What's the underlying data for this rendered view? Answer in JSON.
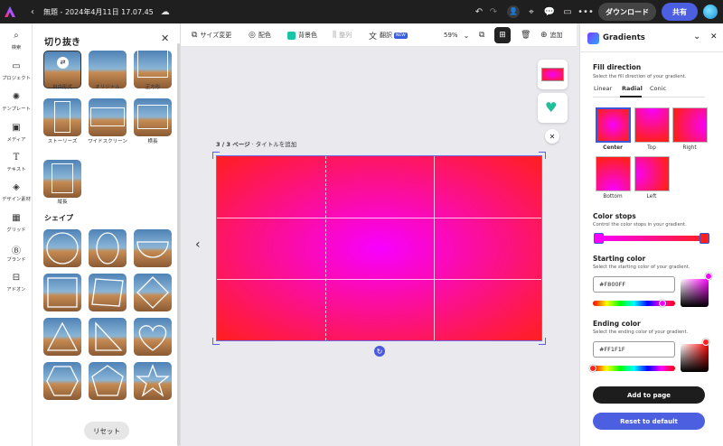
{
  "topbar": {
    "doc_title": "無題 - 2024年4月11日 17.07.45",
    "download_label": "ダウンロード",
    "share_label": "共有",
    "colors": {
      "bar_bg": "#1f1f1f",
      "share": "#4b5fe0",
      "download": "#444444"
    }
  },
  "rail": {
    "items": [
      {
        "label": "検索",
        "icon": "search-icon"
      },
      {
        "label": "プロジェクト",
        "icon": "folder-icon"
      },
      {
        "label": "テンプレート",
        "icon": "templates-icon"
      },
      {
        "label": "メディア",
        "icon": "media-icon"
      },
      {
        "label": "テキスト",
        "icon": "text-icon"
      },
      {
        "label": "デザイン素材",
        "icon": "shapes-icon"
      },
      {
        "label": "グリッド",
        "icon": "grid-icon"
      },
      {
        "label": "ブランド",
        "icon": "brand-icon"
      },
      {
        "label": "アドオン",
        "icon": "addons-icon"
      }
    ]
  },
  "crop_panel": {
    "title": "切り抜き",
    "crop_options": [
      "自由形式",
      "オリジナル",
      "正方形",
      "ストーリーズ",
      "ワイドスクリーン",
      "横長",
      "縦長"
    ],
    "shapes_title": "シェイプ",
    "shapes": [
      "circle",
      "oval",
      "half-circle",
      "square",
      "parallelogram",
      "diamond",
      "triangle",
      "right-triangle",
      "heart",
      "hexagon",
      "pentagon",
      "star"
    ],
    "reset_label": "リセット"
  },
  "canvas_toolbar": {
    "resize_label": "サイズ変更",
    "palette_label": "配色",
    "bg_label": "背景色",
    "align_label": "整列",
    "translate_label": "翻訳",
    "new_badge": "NEW",
    "zoom": "59%",
    "add_label": "追加"
  },
  "canvas": {
    "page_label": "3 / 3 ページ",
    "page_title_placeholder": "タイトルを追加"
  },
  "gradients": {
    "title": "Gradients",
    "fill_direction": {
      "title": "Fill direction",
      "subtitle": "Select the fill direction of your gradient.",
      "tabs": [
        "Linear",
        "Radial",
        "Conic"
      ],
      "active_tab": "Radial",
      "options": [
        "Center",
        "Top",
        "Right",
        "Bottom",
        "Left"
      ],
      "selected": "Center"
    },
    "color_stops": {
      "title": "Color stops",
      "subtitle": "Control the color stops in your gradient."
    },
    "starting_color": {
      "title": "Starting color",
      "subtitle": "Select the starting color of your gradient.",
      "hex": "#F800FF",
      "hue_fraction": 0.83
    },
    "ending_color": {
      "title": "Ending color",
      "subtitle": "Select the ending color of your gradient.",
      "hex": "#FF1F1F",
      "hue_fraction": 0.0
    },
    "add_label": "Add to page",
    "reset_label": "Reset to default"
  }
}
